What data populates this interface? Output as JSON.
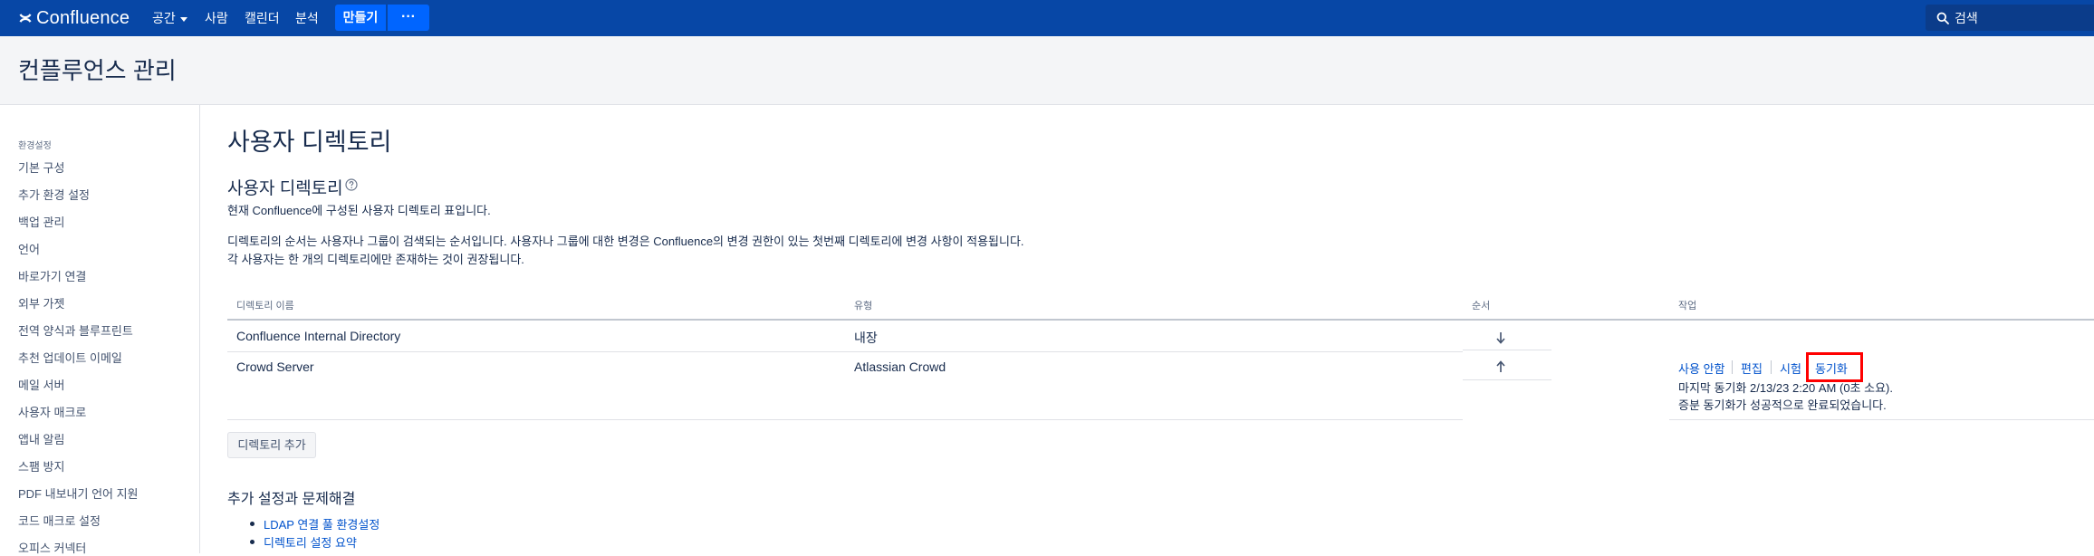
{
  "topnav": {
    "logo_text": "Confluence",
    "logo_icon": "confluence-x-icon",
    "nav_items": [
      "공간",
      "사람",
      "캘린더",
      "분석"
    ],
    "create_label": "만들기",
    "more_label": "···",
    "search_placeholder": "검색",
    "colors": {
      "bar": "#0747a6",
      "button": "#0065ff"
    }
  },
  "admin_header": {
    "title": "컨플루언스 관리"
  },
  "sidebar": {
    "section_label": "환경설정",
    "items": [
      "기본 구성",
      "추가 환경 설정",
      "백업 관리",
      "언어",
      "바로가기 연결",
      "외부 가젯",
      "전역 양식과 블루프린트",
      "추천 업데이트 이메일",
      "메일 서버",
      "사용자 매크로",
      "앱내 알림",
      "스팸 방지",
      "PDF 내보내기 언어 지원",
      "코드 매크로 설정",
      "오피스 커넥터"
    ]
  },
  "main": {
    "page_title": "사용자 디렉토리",
    "section_title": "사용자 디렉토리",
    "help_icon": "question-circle-icon",
    "intro": "현재 Confluence에 구성된 사용자 디렉토리 표입니다.",
    "order_note_1": "디렉토리의 순서는 사용자나 그룹이 검색되는 순서입니다. 사용자나 그룹에 대한 변경은 Confluence의 변경 권한이 있는 첫번째 디렉토리에 변경 사항이 적용됩니다.",
    "order_note_2": "각 사용자는 한 개의 디렉토리에만 존재하는 것이 권장됩니다.",
    "table": {
      "headers": {
        "name": "디렉토리 이름",
        "type": "유형",
        "order": "순서",
        "actions": "작업"
      },
      "rows": [
        {
          "name": "Confluence Internal Directory",
          "type": "내장",
          "order_icon": "arrow-down-icon"
        },
        {
          "name": "Crowd Server",
          "type": "Atlassian Crowd",
          "order_icon": "arrow-up-icon",
          "actions": [
            "사용 안함",
            "편집",
            "시험",
            "동기화"
          ],
          "sync_info_1": "마지막 동기화 2/13/23 2:20 AM (0초 소요).",
          "sync_info_2": "증분 동기화가 성공적으로 완료되었습니다."
        }
      ]
    },
    "add_button": "디렉토리 추가",
    "more_title": "추가 설정과 문제해결",
    "more_links": [
      "LDAP 연결 풀 환경설정",
      "디렉토리 설정 요약"
    ],
    "highlight_color": "#ff0000",
    "link_color": "#0052cc"
  }
}
